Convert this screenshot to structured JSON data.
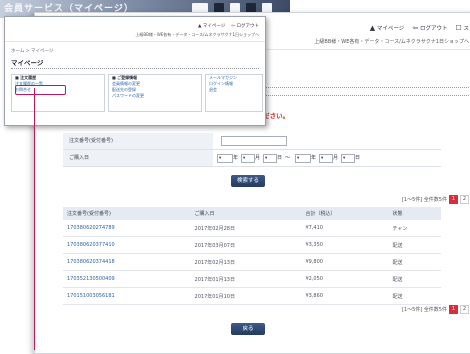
{
  "banner": {
    "title": "会員サービス（マイページ）"
  },
  "main": {
    "header": {
      "links": [
        {
          "icon": "person-icon",
          "label": "マイページ"
        },
        {
          "icon": "logout-icon",
          "label": "ログアウト"
        },
        {
          "icon": "close-icon",
          "label": "ス"
        }
      ],
      "sub": "上級BB様・WE各有・データ・コース/ムネクラサクナ1日ショップへ"
    },
    "note": "ックしてください。",
    "form": {
      "rows": [
        {
          "label": "注文番号(受付番号)"
        },
        {
          "label": "ご購入日"
        }
      ],
      "date_parts": [
        "年",
        "月",
        "日",
        "～",
        "年",
        "月",
        "日"
      ]
    },
    "search_button": "検索する",
    "pager_top": {
      "text": "[1～5件] 全件数5件 ",
      "pages": [
        "1",
        "2"
      ]
    },
    "table": {
      "headers": [
        "注文番号(受付番号)",
        "ご購入日",
        "合計（税込）",
        "状態"
      ],
      "rows": [
        [
          "170380620274789",
          "2017年02月28日",
          "¥7,410",
          "チャン"
        ],
        [
          "170380620377410",
          "2017年03月07日",
          "¥3,350",
          "配送"
        ],
        [
          "170380620374418",
          "2017年02月13日",
          "¥9,800",
          "配送"
        ],
        [
          "170352130500409",
          "2017年01月13日",
          "¥2,050",
          "配送"
        ],
        [
          "170151003056181",
          "2017年01月10日",
          "¥3,860",
          "配送"
        ]
      ]
    },
    "pager_bottom": {
      "text": "[1～5件] 全件数5件 ",
      "pages": [
        "1",
        "2"
      ]
    },
    "back_button": "戻る"
  },
  "inset": {
    "header": {
      "links": [
        "マイページ",
        "ログアウト"
      ],
      "sub": "上級BB様・WE各有・データ・コース/ムネクラサクナ1日ショップへ"
    },
    "breadcrumb": "ホーム > マイページ",
    "title": "マイページ",
    "col1": {
      "head": "■ 注文履歴",
      "items": [
        "注文履歴の一覧",
        "お問合せ"
      ]
    },
    "col2": {
      "head": "■ ご登録情報",
      "items": [
        "会員情報の変更",
        "配送先の登録",
        "パスワードの変更"
      ]
    },
    "col3": {
      "items": [
        "メールマガジン",
        "ログイン情報",
        "退会"
      ]
    }
  },
  "colors": {
    "accent": "#c2185b",
    "button": "#2b4470",
    "alert": "#c42424",
    "page_active": "#d62f3a"
  }
}
